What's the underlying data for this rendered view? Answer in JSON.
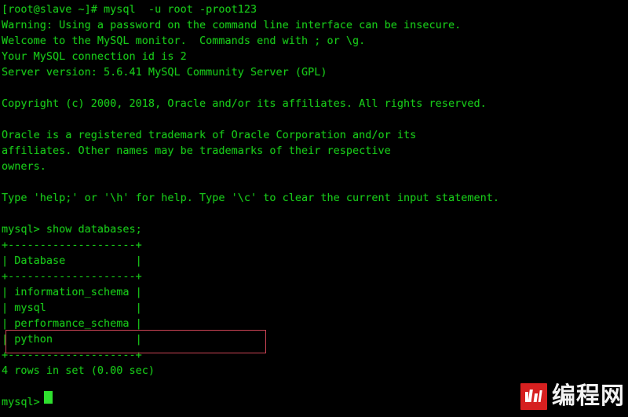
{
  "terminal": {
    "title": "mysql client session",
    "colors": {
      "background": "#000000",
      "foreground": "#18c718",
      "cursor": "#2ee02e",
      "highlight_box": "#cc4455"
    },
    "lines": [
      "[root@slave ~]# mysql  -u root -proot123",
      "Warning: Using a password on the command line interface can be insecure.",
      "Welcome to the MySQL monitor.  Commands end with ; or \\g.",
      "Your MySQL connection id is 2",
      "Server version: 5.6.41 MySQL Community Server (GPL)",
      "",
      "Copyright (c) 2000, 2018, Oracle and/or its affiliates. All rights reserved.",
      "",
      "Oracle is a registered trademark of Oracle Corporation and/or its",
      "affiliates. Other names may be trademarks of their respective",
      "owners.",
      "",
      "Type 'help;' or '\\h' for help. Type '\\c' to clear the current input statement.",
      "",
      "mysql> show databases;",
      "+--------------------+",
      "| Database           |",
      "+--------------------+",
      "| information_schema |",
      "| mysql              |",
      "| performance_schema |",
      "| python             |",
      "+--------------------+",
      "4 rows in set (0.00 sec)",
      "",
      "mysql> "
    ],
    "prompt_hostname": "[root@slave ~]#",
    "command": "mysql  -u root -proot123",
    "sql_query": "show databases;",
    "result_table": {
      "header": "Database",
      "rows": [
        "information_schema",
        "mysql",
        "performance_schema",
        "python"
      ],
      "row_count_text": "4 rows in set (0.00 sec)",
      "highlighted_row": "python"
    },
    "final_prompt": "mysql> "
  },
  "watermark": {
    "badge_icon": "bar-chart-icon",
    "text": "编程网"
  }
}
